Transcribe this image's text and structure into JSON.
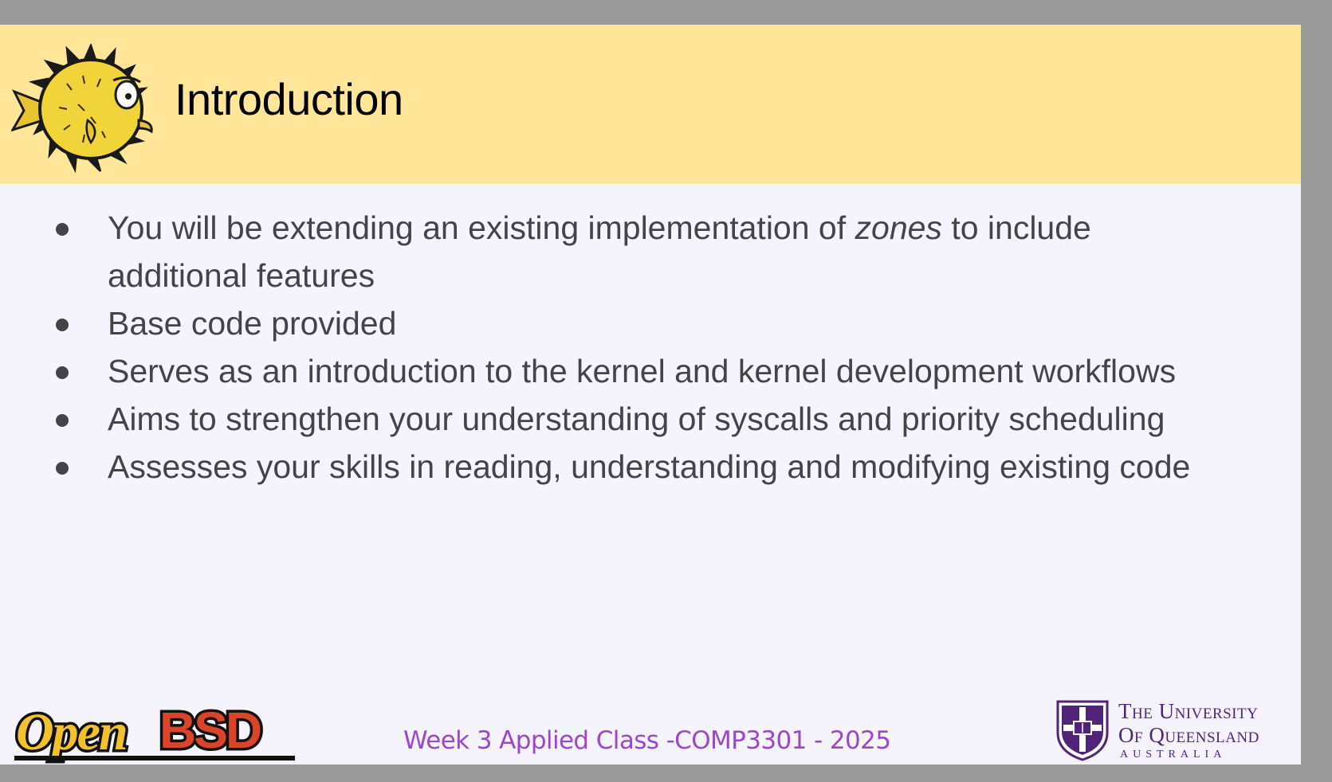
{
  "slide": {
    "title": "Introduction",
    "bullets": [
      {
        "before": "You will be extending an existing implementation of ",
        "emphasis": "zones",
        "after": " to include additional features"
      },
      {
        "before": "Base code provided",
        "emphasis": "",
        "after": ""
      },
      {
        "before": "Serves as an introduction to the kernel and kernel development workflows",
        "emphasis": "",
        "after": ""
      },
      {
        "before": "Aims to strengthen your understanding of syscalls and priority scheduling",
        "emphasis": "",
        "after": ""
      },
      {
        "before": "Assesses your skills in reading, understanding and modifying existing code",
        "emphasis": "",
        "after": ""
      }
    ],
    "footer": "Week 3 Applied Class -COMP3301 - 2025"
  },
  "logos": {
    "openbsd": {
      "icon": "openbsd-logo",
      "text": "OpenBSD"
    },
    "puffy": {
      "icon": "puffy-pufferfish-icon"
    },
    "uq": {
      "icon": "uq-crest-icon",
      "line1": "The University",
      "line2": "Of Queensland",
      "line3": "AUSTRALIA"
    }
  },
  "colors": {
    "header_bg": "#ffe699",
    "slide_bg": "#f5f4fd",
    "frame_bg": "#9b9b9b",
    "body_text": "#444448",
    "footer_text": "#9a47cc",
    "uq_purple": "#51247a"
  }
}
